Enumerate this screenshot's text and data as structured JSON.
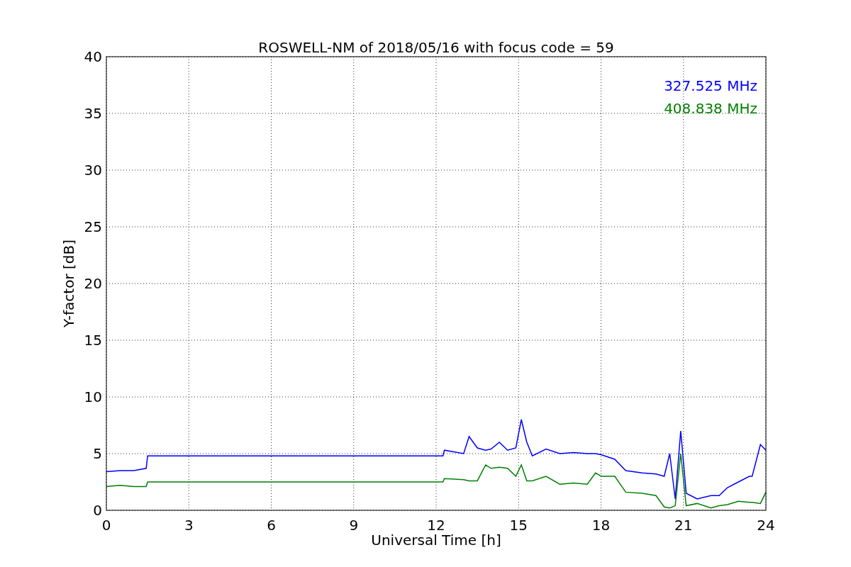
{
  "figure": {
    "chart_data": {
      "type": "line",
      "title": "ROSWELL-NM of 2018/05/16 with focus code = 59",
      "xlabel": "Universal Time [h]",
      "ylabel": "Y-factor [dB]",
      "x": [
        0,
        0.5,
        1,
        1.45,
        1.5,
        6,
        12.25,
        12.3,
        13,
        13.2,
        13.5,
        13.8,
        14,
        14.3,
        14.6,
        14.9,
        15.1,
        15.3,
        15.5,
        16,
        16.5,
        17,
        17.5,
        17.8,
        18,
        18.5,
        18.9,
        19.5,
        20,
        20.3,
        20.5,
        20.7,
        20.9,
        21.1,
        21.5,
        22,
        22.3,
        22.6,
        23,
        23.4,
        23.5,
        23.8,
        24
      ],
      "series": [
        {
          "name": "327.525 MHz",
          "color": "#0000ff",
          "values": [
            3.4,
            3.5,
            3.5,
            3.7,
            4.8,
            4.8,
            4.8,
            5.3,
            5,
            6.5,
            5.5,
            5.3,
            5.4,
            6,
            5.3,
            5.5,
            8,
            6,
            4.8,
            5.4,
            5,
            5.1,
            5,
            5,
            4.9,
            4.5,
            3.5,
            3.3,
            3.2,
            3,
            5,
            1,
            7,
            1.5,
            1,
            1.3,
            1.3,
            2,
            2.5,
            3,
            3,
            5.8,
            5.3
          ]
        },
        {
          "name": "408.838 MHz",
          "color": "#008000",
          "values": [
            2.1,
            2.2,
            2.1,
            2.1,
            2.5,
            2.5,
            2.5,
            2.8,
            2.7,
            2.6,
            2.6,
            4,
            3.7,
            3.8,
            3.7,
            3,
            4,
            2.6,
            2.6,
            3,
            2.3,
            2.4,
            2.3,
            3.3,
            3,
            3,
            1.6,
            1.5,
            1.3,
            0.3,
            0.2,
            0.4,
            5,
            0.4,
            0.6,
            0.2,
            0.4,
            0.5,
            0.8,
            0.7,
            0.7,
            0.6,
            1.6
          ]
        }
      ],
      "grid": true,
      "xlim": [
        0,
        24
      ],
      "ylim": [
        0,
        40
      ],
      "xticks": [
        0,
        3,
        6,
        9,
        12,
        15,
        18,
        21,
        24
      ],
      "yticks": [
        0,
        5,
        10,
        15,
        20,
        25,
        30,
        35,
        40
      ]
    }
  }
}
